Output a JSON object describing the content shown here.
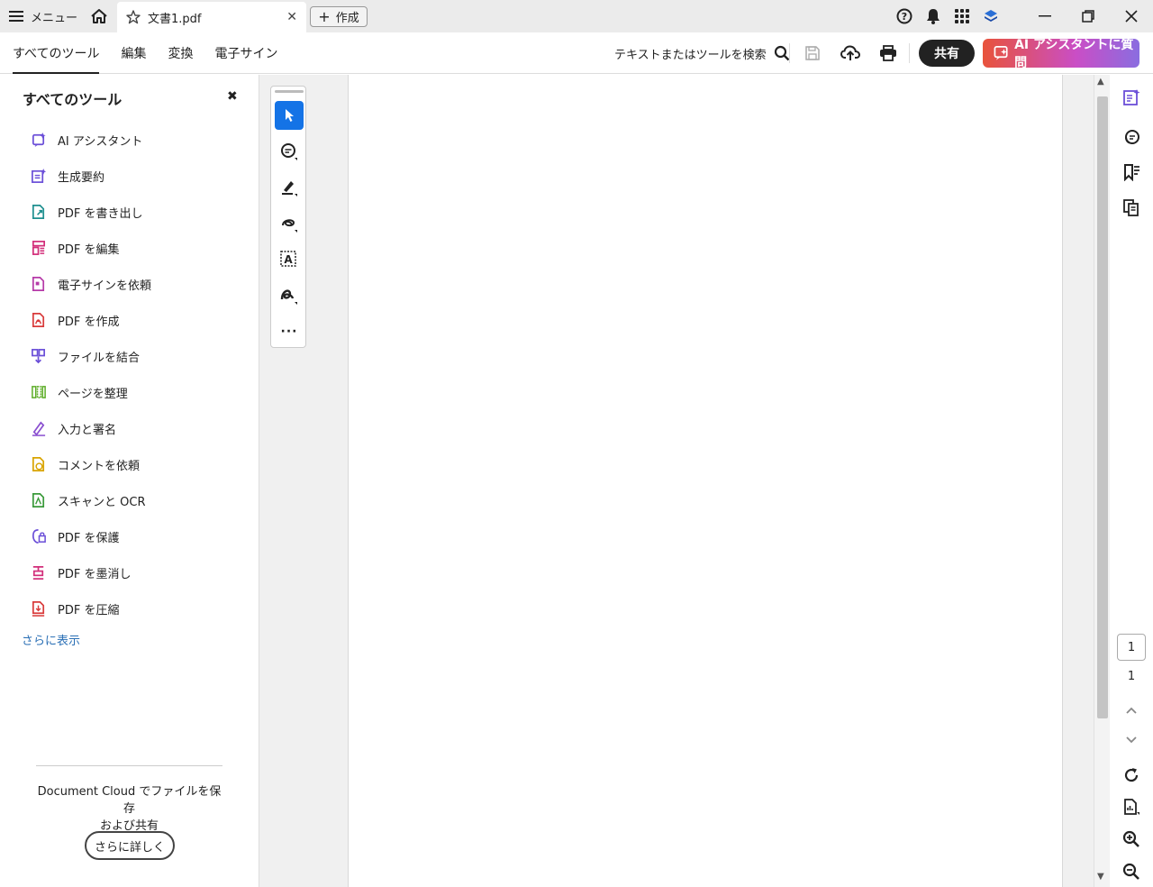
{
  "titlebar": {
    "menu_label": "メニュー",
    "tab_title": "文書1.pdf",
    "create_label": "作成"
  },
  "toolbar": {
    "tabs": [
      "すべてのツール",
      "編集",
      "変換",
      "電子サイン"
    ],
    "search_label": "テキストまたはツールを検索",
    "share_label": "共有",
    "ai_label": "AI アシスタントに質問"
  },
  "left_panel": {
    "title": "すべてのツール",
    "tools": [
      {
        "label": "AI アシスタント",
        "icon": "ai-assistant-icon",
        "color": "#6b4fd8"
      },
      {
        "label": "生成要約",
        "icon": "generative-summary-icon",
        "color": "#6b4fd8"
      },
      {
        "label": "PDF を書き出し",
        "icon": "export-pdf-icon",
        "color": "#1e8f8f"
      },
      {
        "label": "PDF を編集",
        "icon": "edit-pdf-icon",
        "color": "#d22e7a"
      },
      {
        "label": "電子サインを依頼",
        "icon": "request-esign-icon",
        "color": "#b63aa8"
      },
      {
        "label": "PDF を作成",
        "icon": "create-pdf-icon",
        "color": "#d93b3b"
      },
      {
        "label": "ファイルを結合",
        "icon": "combine-files-icon",
        "color": "#6b4fd8"
      },
      {
        "label": "ページを整理",
        "icon": "organize-pages-icon",
        "color": "#5fae2a"
      },
      {
        "label": "入力と署名",
        "icon": "fill-sign-icon",
        "color": "#8a4fd0"
      },
      {
        "label": "コメントを依頼",
        "icon": "request-comments-icon",
        "color": "#d9a400"
      },
      {
        "label": "スキャンと OCR",
        "icon": "scan-ocr-icon",
        "color": "#3a9a3a"
      },
      {
        "label": "PDF を保護",
        "icon": "protect-pdf-icon",
        "color": "#6b4fd8"
      },
      {
        "label": "PDF を墨消し",
        "icon": "redact-pdf-icon",
        "color": "#d22e7a"
      },
      {
        "label": "PDF を圧縮",
        "icon": "compress-pdf-icon",
        "color": "#d93b3b"
      }
    ],
    "more_label": "さらに表示",
    "cloud_text_1": "Document Cloud でファイルを保存",
    "cloud_text_2": "および共有",
    "learn_more_label": "さらに詳しく"
  },
  "navigation": {
    "current_page": "1",
    "total_pages": "1"
  }
}
